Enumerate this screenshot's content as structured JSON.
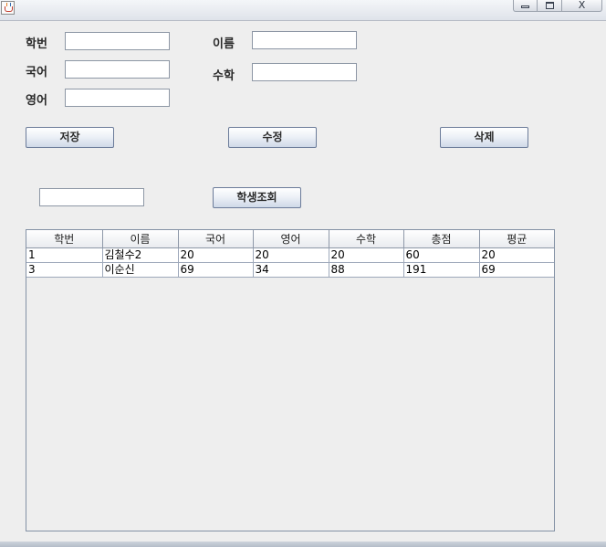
{
  "window": {
    "icon": "java-icon",
    "controls": {
      "minimize": "minimize-icon",
      "maximize": "maximize-icon",
      "close": "close-icon",
      "close_glyph": "X"
    }
  },
  "form": {
    "student_id_label": "학번",
    "name_label": "이름",
    "korean_label": "국어",
    "math_label": "수학",
    "english_label": "영어",
    "student_id_value": "",
    "name_value": "",
    "korean_value": "",
    "math_value": "",
    "english_value": ""
  },
  "buttons": {
    "save": "저장",
    "edit": "수정",
    "delete": "삭제",
    "search": "학생조회"
  },
  "search": {
    "value": ""
  },
  "table": {
    "headers": [
      "학번",
      "이름",
      "국어",
      "영어",
      "수학",
      "총점",
      "평균"
    ],
    "rows": [
      [
        "1",
        "김철수2",
        "20",
        "20",
        "20",
        "60",
        "20"
      ],
      [
        "3",
        "이순신",
        "69",
        "34",
        "88",
        "191",
        "69"
      ]
    ]
  }
}
